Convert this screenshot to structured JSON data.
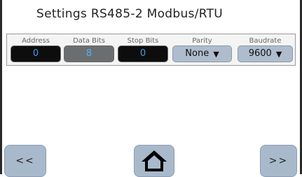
{
  "title": "Settings RS485-2 Modbus/RTU",
  "fields": {
    "address": {
      "label": "Address",
      "value": "0"
    },
    "data_bits": {
      "label": "Data Bits",
      "value": "8"
    },
    "stop_bits": {
      "label": "Stop Bits",
      "value": "0"
    },
    "parity": {
      "label": "Parity",
      "value": "None"
    },
    "baudrate": {
      "label": "Baudrate",
      "value": "9600"
    }
  },
  "nav": {
    "prev_label": "<<",
    "next_label": ">>",
    "home_icon": "home-icon"
  }
}
